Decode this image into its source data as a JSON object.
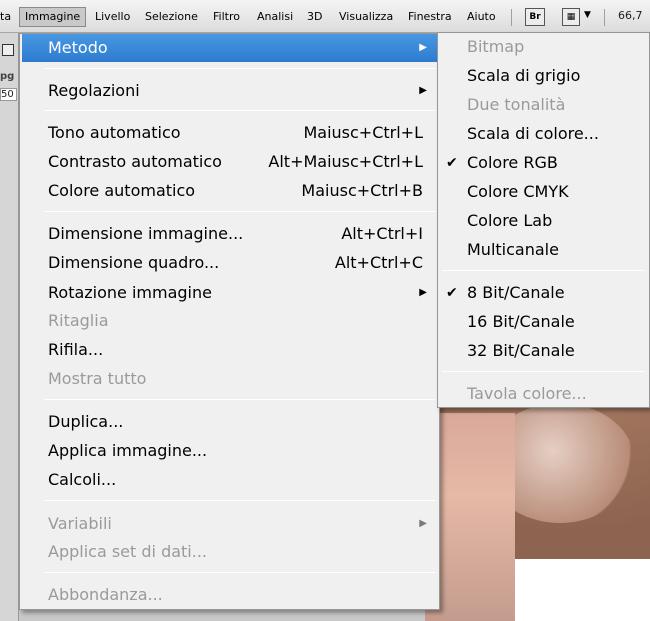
{
  "menubar": {
    "items": [
      "ta",
      "Immagine",
      "Livello",
      "Selezione",
      "Filtro",
      "Analisi",
      "3D",
      "Visualizza",
      "Finestra",
      "Aiuto"
    ],
    "bridge_label": "Br",
    "zoom": "66,7"
  },
  "left_panel": {
    "label_pg": "pg",
    "field_value": "50"
  },
  "menu": {
    "items": [
      {
        "label": "Metodo",
        "shortcut": "",
        "submenu": true,
        "highlighted": true
      },
      {
        "label": "Regolazioni",
        "shortcut": "",
        "submenu": true
      },
      {
        "label": "Tono automatico",
        "shortcut": "Maiusc+Ctrl+L"
      },
      {
        "label": "Contrasto automatico",
        "shortcut": "Alt+Maiusc+Ctrl+L"
      },
      {
        "label": "Colore automatico",
        "shortcut": "Maiusc+Ctrl+B"
      },
      {
        "label": "Dimensione immagine...",
        "shortcut": "Alt+Ctrl+I"
      },
      {
        "label": "Dimensione quadro...",
        "shortcut": "Alt+Ctrl+C"
      },
      {
        "label": "Rotazione immagine",
        "shortcut": "",
        "submenu": true
      },
      {
        "label": "Ritaglia",
        "shortcut": "",
        "disabled": true
      },
      {
        "label": "Rifila...",
        "shortcut": ""
      },
      {
        "label": "Mostra tutto",
        "shortcut": "",
        "disabled": true
      },
      {
        "label": "Duplica...",
        "shortcut": ""
      },
      {
        "label": "Applica immagine...",
        "shortcut": ""
      },
      {
        "label": "Calcoli...",
        "shortcut": ""
      },
      {
        "label": "Variabili",
        "shortcut": "",
        "submenu": true,
        "disabled": true
      },
      {
        "label": "Applica set di dati...",
        "shortcut": "",
        "disabled": true
      },
      {
        "label": "Abbondanza...",
        "shortcut": "",
        "disabled": true
      }
    ]
  },
  "submenu": {
    "items": [
      {
        "label": "Bitmap",
        "disabled": true
      },
      {
        "label": "Scala di grigio"
      },
      {
        "label": "Due tonalità",
        "disabled": true
      },
      {
        "label": "Scala di colore..."
      },
      {
        "label": "Colore RGB",
        "checked": true
      },
      {
        "label": "Colore CMYK"
      },
      {
        "label": "Colore Lab"
      },
      {
        "label": "Multicanale"
      },
      {
        "label": "8 Bit/Canale",
        "checked": true
      },
      {
        "label": "16 Bit/Canale"
      },
      {
        "label": "32 Bit/Canale"
      },
      {
        "label": "Tavola colore...",
        "disabled": true
      }
    ]
  },
  "glyphs": {
    "arrow": "▶",
    "check": "✔"
  },
  "colors": {
    "highlight": "#3c8ad6",
    "disabled_text": "#9a9a9a",
    "menu_bg": "#f0f0f0"
  }
}
